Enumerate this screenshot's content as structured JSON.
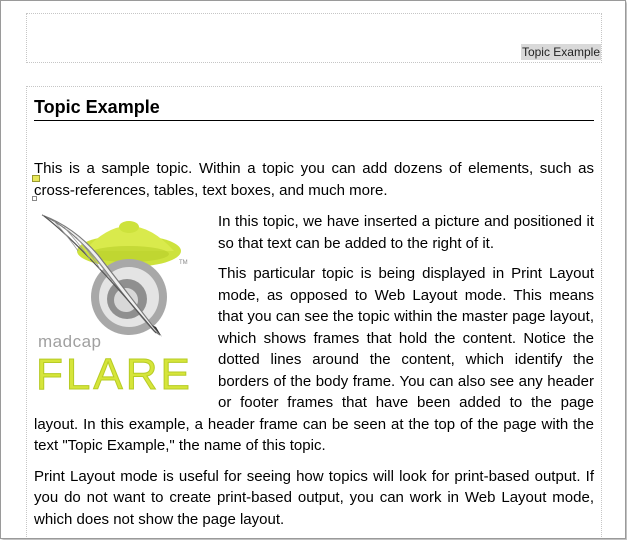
{
  "header": {
    "text": "Topic Example"
  },
  "topic": {
    "title": "Topic Example",
    "intro": "This is a sample topic. Within a topic you can add dozens of elements, such as cross-references, tables, text boxes, and much more.",
    "para_picture": "In this topic, we have inserted a picture and posi­tioned it so that text can be added to the right of it.",
    "para_layout": "This particular topic is being displayed in Print Layout mode, as opposed to Web Layout mode. This means that you can see the topic within the master page lay­out, which shows frames that hold the content. Notice the dotted lines around the content, which identify the borders of the body frame. You can also see any header or footer frames that have been added to the page layout. In this example, a header frame can be seen at the top of the page with the text \"Topic Example,\" the name of this topic.",
    "para_print": "Print Layout mode is useful for seeing how topics will look for print-based output. If you do not want to create print-based output, you can work in Web Layout mode, which does not show the page layout."
  },
  "logo": {
    "brand_small": "madcap",
    "brand_big": "FLARE",
    "trademark": "TM",
    "colors": {
      "green": "#cde23c",
      "green_dark": "#9fb81a",
      "gray": "#8f8f8f",
      "gray_light": "#d6d6d6"
    }
  }
}
